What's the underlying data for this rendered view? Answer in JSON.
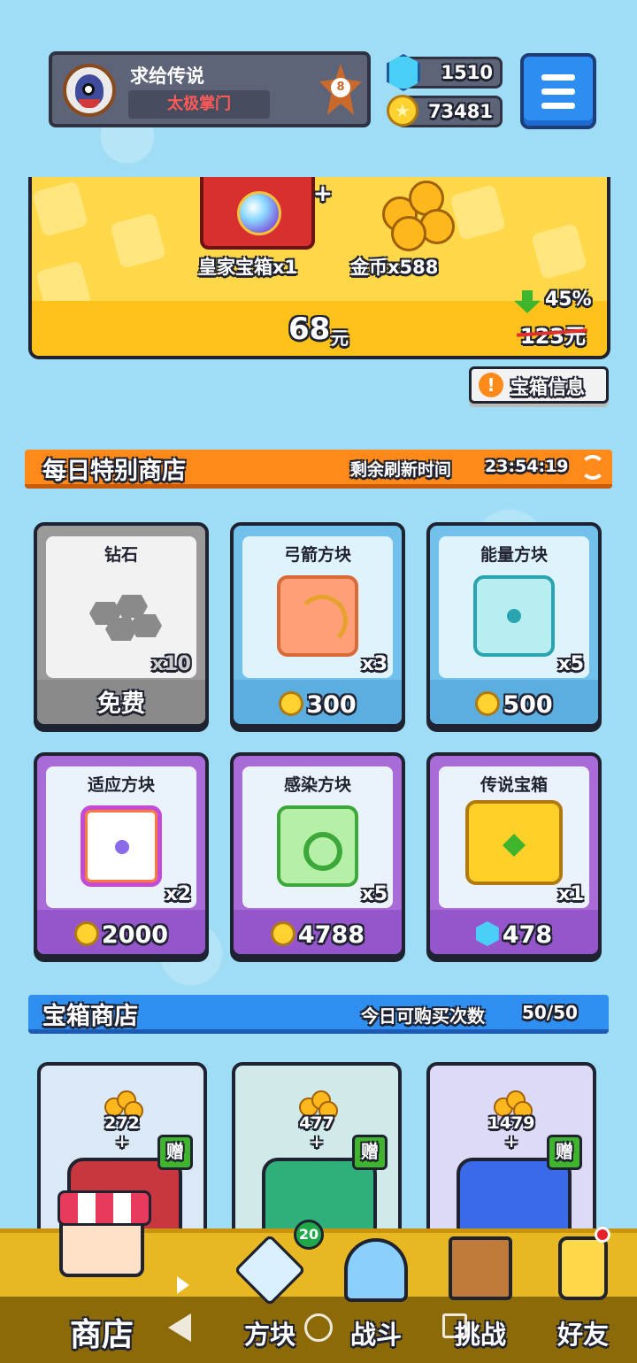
{
  "player": {
    "name": "求给传说",
    "title": "太极掌门",
    "rank": "8"
  },
  "currency": {
    "gems": "1510",
    "coins": "73481"
  },
  "offer": {
    "item1_label": "皇家宝箱x1",
    "item2_label": "金币x588",
    "plus": "+",
    "price": "68",
    "price_unit": "元",
    "discount": "45%",
    "original_price": "123元"
  },
  "chest_info_button": {
    "icon": "!",
    "label": "宝箱信息"
  },
  "daily_shop": {
    "title": "每日特别商店",
    "refresh_label": "剩余刷新时间",
    "refresh_time": "23:54:19",
    "items": [
      {
        "name": "钻石",
        "qty": "x10",
        "price": "免费",
        "currency": "none",
        "icon": "diamond-ore-icon"
      },
      {
        "name": "弓箭方块",
        "qty": "x3",
        "price": "300",
        "currency": "coin",
        "icon": "bow-block-icon"
      },
      {
        "name": "能量方块",
        "qty": "x5",
        "price": "500",
        "currency": "coin",
        "icon": "energy-block-icon"
      },
      {
        "name": "适应方块",
        "qty": "x2",
        "price": "2000",
        "currency": "coin",
        "icon": "adapt-block-icon"
      },
      {
        "name": "感染方块",
        "qty": "x5",
        "price": "4788",
        "currency": "coin",
        "icon": "infect-block-icon"
      },
      {
        "name": "传说宝箱",
        "qty": "x1",
        "price": "478",
        "currency": "gem",
        "icon": "legend-chest-icon"
      }
    ]
  },
  "chest_shop": {
    "title": "宝箱商店",
    "limit_label": "今日可购买次数",
    "limit_value": "50/50",
    "items": [
      {
        "coins": "272",
        "plus": "+",
        "gift": "赠",
        "color": "#c8373f"
      },
      {
        "coins": "477",
        "plus": "+",
        "gift": "赠",
        "color": "#2fb07a"
      },
      {
        "coins": "1479",
        "plus": "+",
        "gift": "赠",
        "color": "#3a6ae8"
      }
    ]
  },
  "nav": {
    "shop": "商店",
    "blocks": "方块",
    "blocks_badge": "20",
    "battle": "战斗",
    "challenge": "挑战",
    "friends": "好友"
  },
  "colors": {
    "daily_header": "#ff8a1a",
    "chest_header": "#2f8ff0",
    "offer_bg": "#ffd84a",
    "nav_bg": "#e8b822"
  }
}
